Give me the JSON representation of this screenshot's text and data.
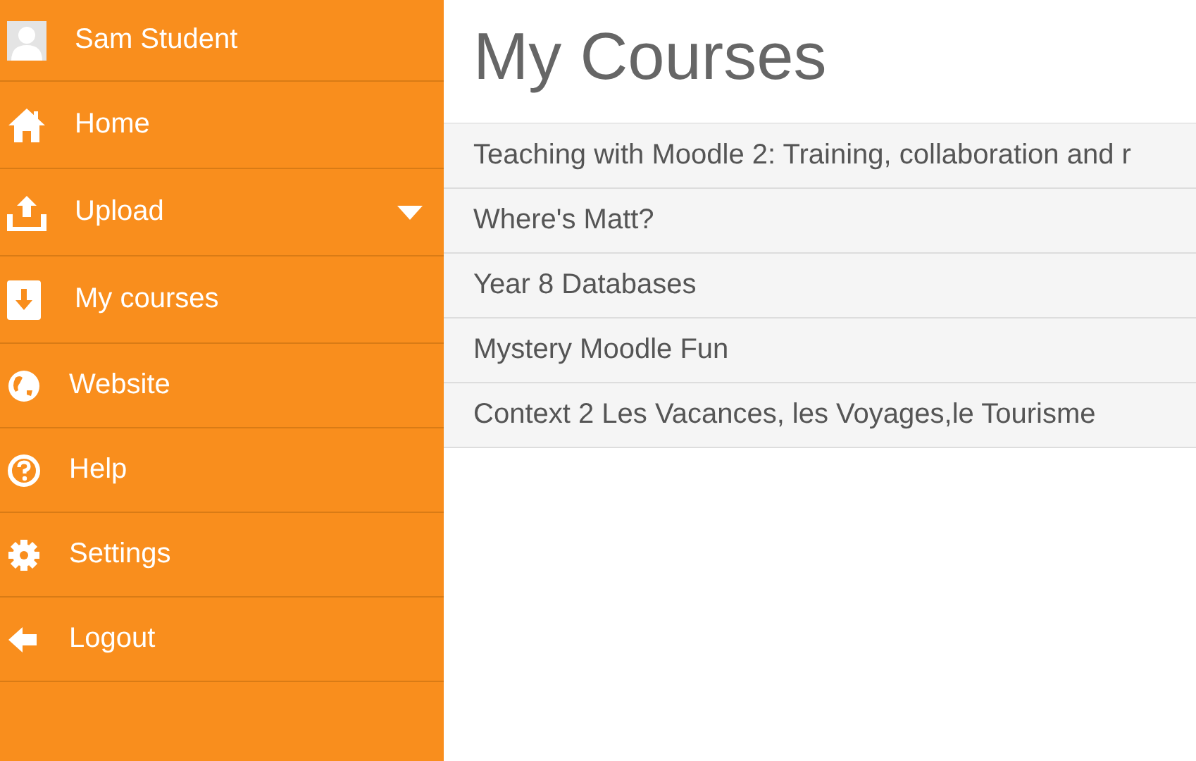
{
  "sidebar": {
    "user": {
      "name": "Sam Student"
    },
    "items": [
      {
        "label": "Home",
        "submenu": false
      },
      {
        "label": "Upload",
        "submenu": true
      },
      {
        "label": "My courses",
        "submenu": false
      },
      {
        "label": "Website",
        "submenu": false
      },
      {
        "label": "Help",
        "submenu": false
      },
      {
        "label": "Settings",
        "submenu": false
      },
      {
        "label": "Logout",
        "submenu": false
      }
    ]
  },
  "main": {
    "title": "My Courses",
    "courses": [
      "Teaching with Moodle 2: Training, collaboration and r",
      "Where's Matt?",
      "Year 8 Databases",
      "Mystery Moodle Fun",
      "Context 2 Les Vacances, les Voyages,le Tourisme"
    ]
  }
}
